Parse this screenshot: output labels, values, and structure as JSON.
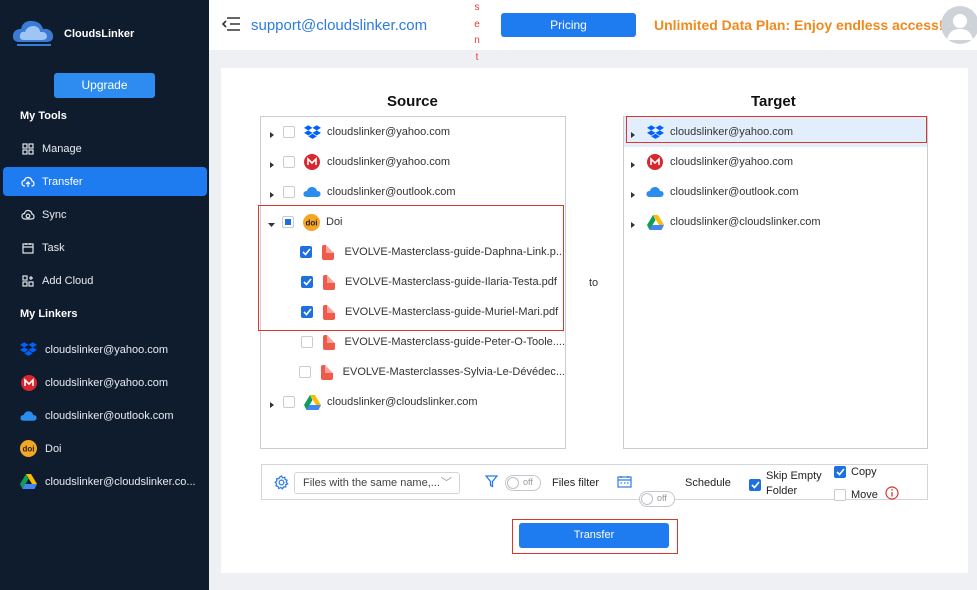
{
  "app": {
    "name": "CloudsLinker"
  },
  "sidebar": {
    "upgrade_label": "Upgrade",
    "tools_title": "My Tools",
    "tools": [
      {
        "label": "Manage",
        "icon": "grid-icon"
      },
      {
        "label": "Transfer",
        "icon": "cloud-upload-icon",
        "active": true
      },
      {
        "label": "Sync",
        "icon": "cloud-sync-icon"
      },
      {
        "label": "Task",
        "icon": "calendar-icon"
      },
      {
        "label": "Add Cloud",
        "icon": "add-grid-icon"
      }
    ],
    "linkers_title": "My Linkers",
    "linkers": [
      {
        "label": "cloudslinker@yahoo.com",
        "icon": "dropbox-icon"
      },
      {
        "label": "cloudslinker@yahoo.com",
        "icon": "mega-icon"
      },
      {
        "label": "cloudslinker@outlook.com",
        "icon": "onedrive-icon"
      },
      {
        "label": "Doi",
        "icon": "doi-icon"
      },
      {
        "label": "cloudslinker@cloudslinker.co...",
        "icon": "google-drive-icon"
      }
    ]
  },
  "header": {
    "support_email": "support@cloudslinker.com",
    "sent_letters": [
      "s",
      "e",
      "n",
      "t"
    ],
    "pricing_label": "Pricing",
    "promo_text": "Unlimited Data Plan: Enjoy endless access!"
  },
  "source": {
    "title": "Source",
    "rows": [
      {
        "label": "cloudslinker@yahoo.com",
        "icon": "dropbox-icon",
        "expandable": true,
        "checked": false
      },
      {
        "label": "cloudslinker@yahoo.com",
        "icon": "mega-icon",
        "expandable": true,
        "checked": false
      },
      {
        "label": "cloudslinker@outlook.com",
        "icon": "onedrive-icon",
        "expandable": true,
        "checked": false
      },
      {
        "label": "Doi",
        "icon": "doi-icon",
        "expandable": true,
        "expanded": true,
        "partial": true
      },
      {
        "label": "EVOLVE-Masterclass-guide-Daphna-Link.p...",
        "icon": "pdf-icon",
        "child": true,
        "checked": true
      },
      {
        "label": "EVOLVE-Masterclass-guide-Ilaria-Testa.pdf",
        "icon": "pdf-icon",
        "child": true,
        "checked": true
      },
      {
        "label": "EVOLVE-Masterclass-guide-Muriel-Mari.pdf",
        "icon": "pdf-icon",
        "child": true,
        "checked": true
      },
      {
        "label": "EVOLVE-Masterclass-guide-Peter-O-Toole....",
        "icon": "pdf-icon",
        "child": true,
        "checked": false
      },
      {
        "label": "EVOLVE-Masterclasses-Sylvia-Le-Dévédec...",
        "icon": "pdf-icon",
        "child": true,
        "checked": false
      },
      {
        "label": "cloudslinker@cloudslinker.com",
        "icon": "google-drive-icon",
        "expandable": true,
        "checked": false
      }
    ]
  },
  "to_label": "to",
  "target": {
    "title": "Target",
    "rows": [
      {
        "label": "cloudslinker@yahoo.com",
        "icon": "dropbox-icon",
        "selected": true
      },
      {
        "label": "cloudslinker@yahoo.com",
        "icon": "mega-icon"
      },
      {
        "label": "cloudslinker@outlook.com",
        "icon": "onedrive-icon"
      },
      {
        "label": "cloudslinker@cloudslinker.com",
        "icon": "google-drive-icon"
      }
    ]
  },
  "options": {
    "conflict_select": "Files with the same name,...",
    "filter_toggle": "off",
    "filter_label": "Files filter",
    "schedule_toggle": "off",
    "schedule_label": "Schedule",
    "skip_empty_line1": "Skip Empty",
    "skip_empty_line2": "Folder",
    "skip_empty_checked": true,
    "copy_label": "Copy",
    "copy_checked": true,
    "move_label": "Move",
    "move_checked": false
  },
  "transfer_button": "Transfer",
  "colors": {
    "sidebar_bg": "#0f1c2e",
    "accent": "#1e7bf0",
    "promo": "#f08a1c",
    "highlight_border": "#d9372c"
  }
}
